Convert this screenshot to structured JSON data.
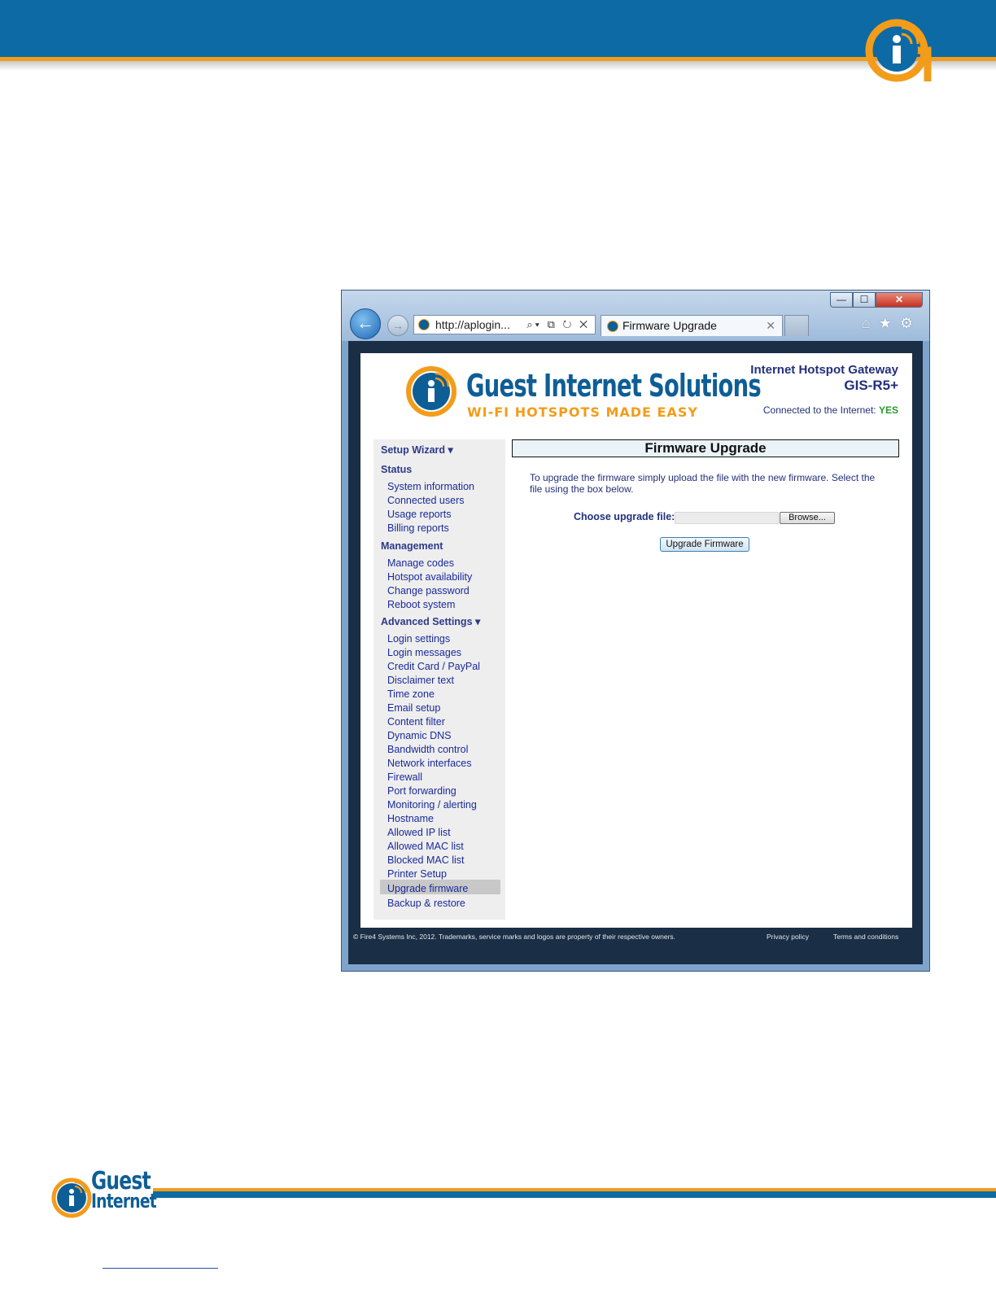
{
  "browser": {
    "window_controls": {
      "minimize": "—",
      "maximize": "☐",
      "close": "✕"
    },
    "address": "http://aplogin...",
    "address_tools": "⌕▾ ⧉ ↻ ✕",
    "tab_title": "Firmware Upgrade",
    "tab_close": "✕",
    "toolbar_icons": "⌂★⚙",
    "icons": [
      "back-arrow-icon",
      "forward-arrow-icon",
      "search-icon",
      "compat-icon",
      "refresh-icon",
      "stop-icon",
      "home-icon",
      "favorites-star-icon",
      "settings-gear-icon"
    ]
  },
  "site": {
    "brand": "Guest Internet Solutions",
    "tagline": "WI-FI HOTSPOTS MADE EASY",
    "product_line1": "Internet Hotspot Gateway",
    "product_line2": "GIS-R5+",
    "connected_label": "Connected to the Internet:",
    "connected_value": "YES",
    "colors": {
      "brand_blue": "#0e5e96",
      "brand_orange": "#f39c1a",
      "nav_text": "#1a2a9a",
      "connected_yes": "#2a9a2a"
    }
  },
  "sidebar": {
    "setup_wizard": "Setup Wizard ▾",
    "status_heading": "Status",
    "status_items": [
      "System information",
      "Connected users",
      "Usage reports",
      "Billing reports"
    ],
    "management_heading": "Management",
    "management_items": [
      "Manage codes",
      "Hotspot availability",
      "Change password",
      "Reboot system"
    ],
    "advanced_heading": "Advanced Settings ▾",
    "advanced_items": [
      "Login settings",
      "Login messages",
      "Credit Card / PayPal",
      "Disclaimer text",
      "Time zone",
      "Email setup",
      "Content filter",
      "Dynamic DNS",
      "Bandwidth control",
      "Network interfaces",
      "Firewall",
      "Port forwarding",
      "Monitoring / alerting",
      "Hostname",
      "Allowed IP list",
      "Allowed MAC list",
      "Blocked MAC list",
      "Printer Setup",
      "Upgrade firmware",
      "Backup & restore"
    ],
    "selected": "Upgrade firmware"
  },
  "main": {
    "title": "Firmware Upgrade",
    "intro": "To upgrade the firmware simply upload the file with the new firmware. Select the file using the box below.",
    "upload_label": "Choose upgrade file:",
    "file_value": "",
    "browse_label": "Browse...",
    "submit_label": "Upgrade Firmware"
  },
  "page_footer": {
    "copyright": "© Fire4 Systems Inc, 2012. Trademarks, service marks and logos are property of their respective owners.",
    "privacy": "Privacy policy",
    "terms": "Terms and conditions"
  },
  "doc_footer": {
    "logo_line1": "Guest",
    "logo_line2": "Internet"
  }
}
